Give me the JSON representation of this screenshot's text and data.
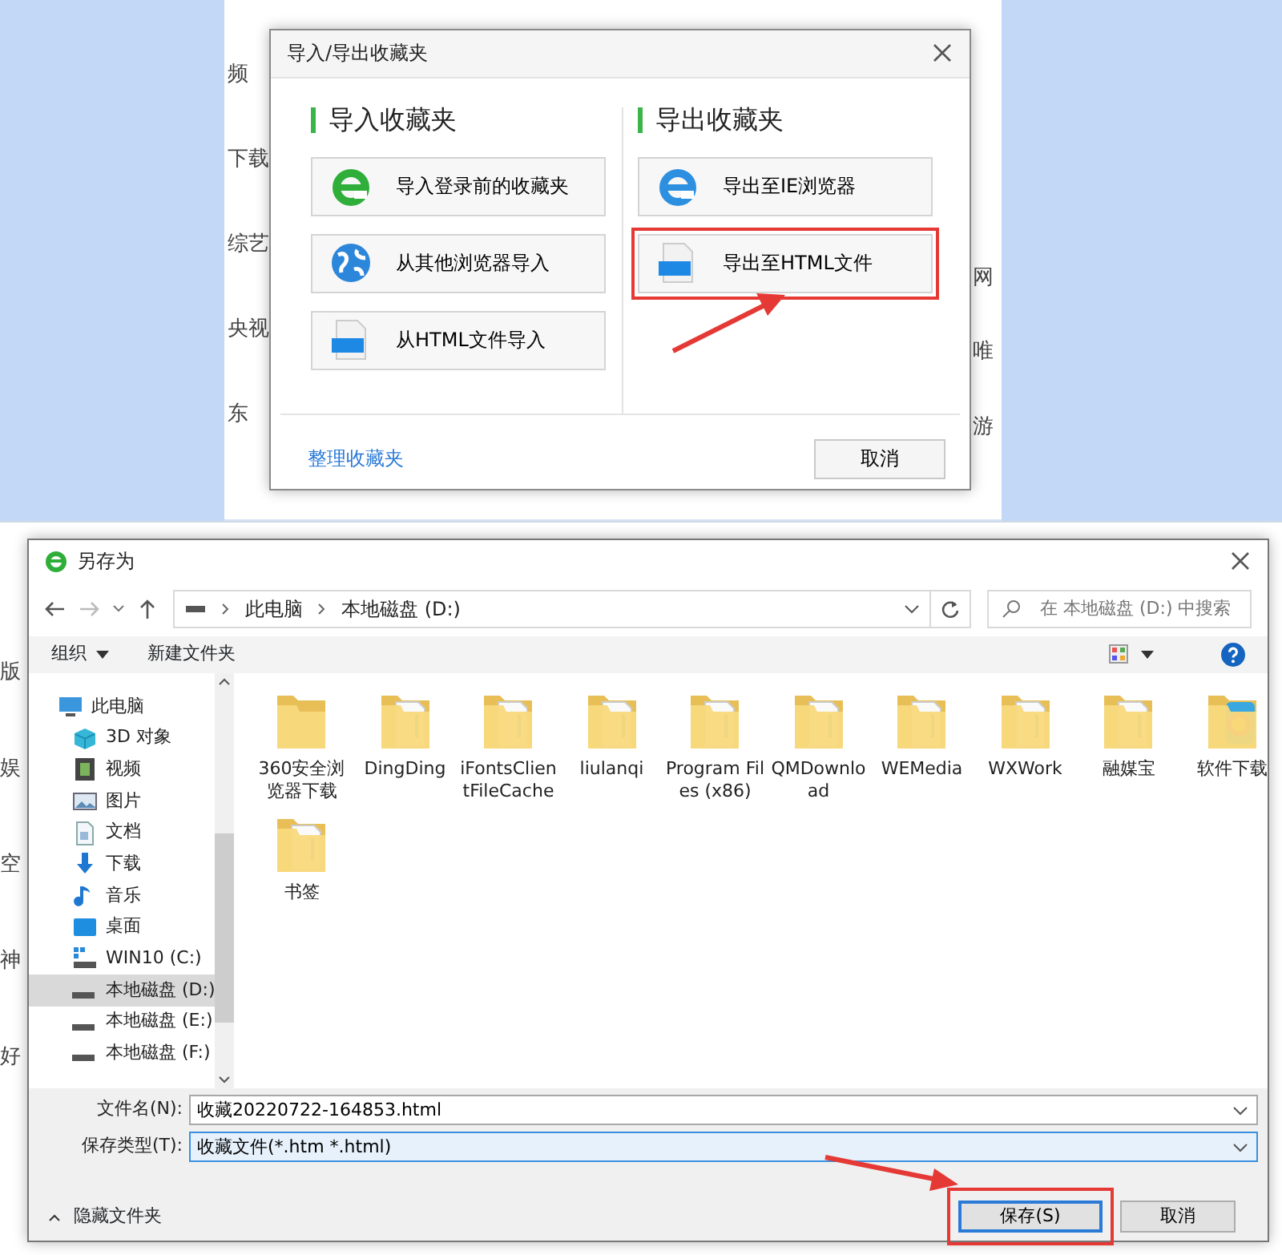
{
  "background_page": {
    "top_left": [
      "频",
      "下载",
      "综艺",
      "央视",
      "东"
    ],
    "top_right": [
      "网",
      "唯",
      "游"
    ],
    "bottom_left": [
      "版",
      "娱",
      "空",
      "神",
      "好"
    ]
  },
  "favorites_dialog": {
    "title": "导入/导出收藏夹",
    "sections": [
      {
        "heading": "导入收藏夹",
        "buttons": [
          {
            "label": "导入登录前的收藏夹",
            "kind": "ie-green",
            "highlighted": false
          },
          {
            "label": "从其他浏览器导入",
            "kind": "globe",
            "highlighted": false
          },
          {
            "label": "从HTML文件导入",
            "kind": "html",
            "highlighted": false
          }
        ]
      },
      {
        "heading": "导出收藏夹",
        "buttons": [
          {
            "label": "导出至IE浏览器",
            "kind": "ie",
            "highlighted": false
          },
          {
            "label": "导出至HTML文件",
            "kind": "html",
            "highlighted": true
          }
        ]
      }
    ],
    "link": "整理收藏夹",
    "cancel": "取消"
  },
  "save_dialog": {
    "title": "另存为",
    "breadcrumb": [
      "此电脑",
      "本地磁盘 (D:)"
    ],
    "search_placeholder": "在 本地磁盘 (D:) 中搜索",
    "organize": "组织",
    "new_folder": "新建文件夹",
    "sidebar": [
      {
        "label": "此电脑",
        "kind": "pc",
        "selected": false,
        "children": [
          {
            "label": "3D 对象",
            "kind": "cube",
            "selected": false
          },
          {
            "label": "视频",
            "kind": "video",
            "selected": false
          },
          {
            "label": "图片",
            "kind": "picture",
            "selected": false
          },
          {
            "label": "文档",
            "kind": "doc",
            "selected": false
          },
          {
            "label": "下载",
            "kind": "download",
            "selected": false
          },
          {
            "label": "音乐",
            "kind": "music",
            "selected": false
          },
          {
            "label": "桌面",
            "kind": "desktop",
            "selected": false
          },
          {
            "label": "WIN10 (C:)",
            "kind": "windrive",
            "selected": false
          },
          {
            "label": "本地磁盘 (D:)",
            "kind": "drive",
            "selected": true
          },
          {
            "label": "本地磁盘 (E:)",
            "kind": "drive",
            "selected": false
          },
          {
            "label": "本地磁盘 (F:)",
            "kind": "drive",
            "selected": false
          }
        ]
      }
    ],
    "files": [
      {
        "name": "360安全浏览器下载",
        "kind": "plain"
      },
      {
        "name": "DingDing",
        "kind": "files"
      },
      {
        "name": "iFontsClientFileCache",
        "kind": "files"
      },
      {
        "name": "liulanqi",
        "kind": "files"
      },
      {
        "name": "Program Files (x86)",
        "kind": "files"
      },
      {
        "name": "QMDownload",
        "kind": "files"
      },
      {
        "name": "WEMedia",
        "kind": "files"
      },
      {
        "name": "WXWork",
        "kind": "files"
      },
      {
        "name": "融媒宝",
        "kind": "files"
      },
      {
        "name": "软件下载",
        "kind": "colorful"
      },
      {
        "name": "书签",
        "kind": "files"
      }
    ],
    "filename_label": "文件名(N):",
    "filename": "收藏20220722-164853.html",
    "type_label": "保存类型(T):",
    "type": "收藏文件(*.htm *.html)",
    "hide_folders": "隐藏文件夹",
    "save": {
      "label": "保存(S)",
      "highlighted": true
    },
    "cancel": "取消"
  }
}
